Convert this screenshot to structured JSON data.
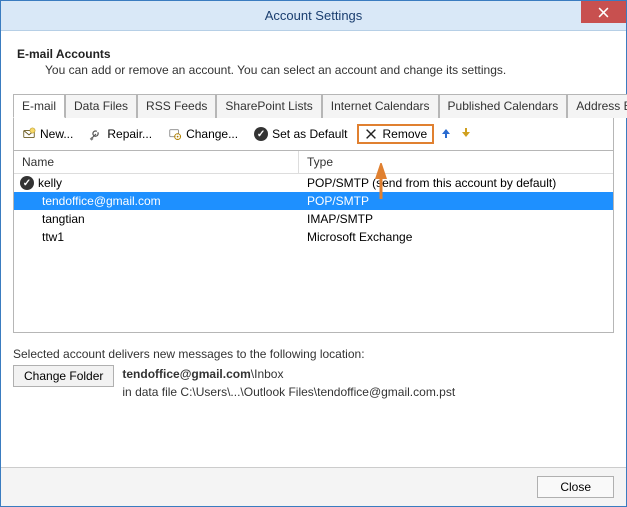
{
  "window": {
    "title": "Account Settings"
  },
  "header": {
    "title": "E-mail Accounts",
    "subtitle": "You can add or remove an account. You can select an account and change its settings."
  },
  "tabs": {
    "email": "E-mail",
    "datafiles": "Data Files",
    "rss": "RSS Feeds",
    "sharepoint": "SharePoint Lists",
    "ical": "Internet Calendars",
    "pubcal": "Published Calendars",
    "addr": "Address Books"
  },
  "toolbar": {
    "new": "New...",
    "repair": "Repair...",
    "change": "Change...",
    "setdefault": "Set as Default",
    "remove": "Remove"
  },
  "columns": {
    "name": "Name",
    "type": "Type"
  },
  "accounts": [
    {
      "name": "kelly",
      "type": "POP/SMTP (send from this account by default)",
      "default": true,
      "selected": false
    },
    {
      "name": "tendoffice@gmail.com",
      "type": "POP/SMTP",
      "default": false,
      "selected": true
    },
    {
      "name": "tangtian",
      "type": "IMAP/SMTP",
      "default": false,
      "selected": false
    },
    {
      "name": "ttw1",
      "type": "Microsoft Exchange",
      "default": false,
      "selected": false
    }
  ],
  "delivery": {
    "label": "Selected account delivers new messages to the following location:",
    "change_folder": "Change Folder",
    "location_main": "tendoffice@gmail.com",
    "location_sub": "\\Inbox",
    "datafile": "in data file C:\\Users\\...\\Outlook Files\\tendoffice@gmail.com.pst"
  },
  "footer": {
    "close": "Close"
  }
}
